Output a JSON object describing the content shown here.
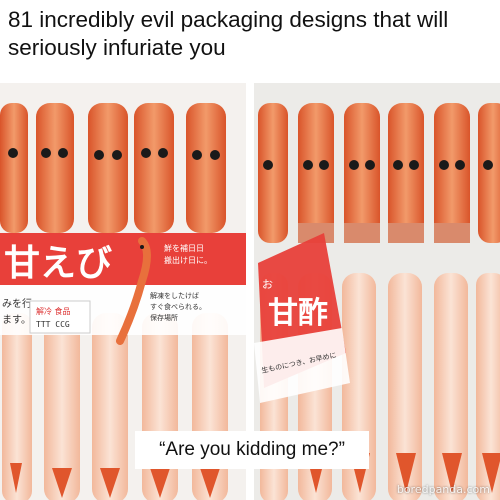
{
  "headline": "81 incredibly evil packaging designs that will seriously infuriate you",
  "left_photo": {
    "label_main": "甘えび",
    "label_small_1": "鮮を補日日",
    "label_small_2": "搬出け日に。",
    "label_small_3": "みを行",
    "label_small_4": "ます。",
    "label_small_5": "解凍をしたけば",
    "label_small_6": "すぐ食べられる。",
    "label_small_7": "保存場所",
    "sticker_text": "解冷 食品",
    "sticker_code": "TTT CCG"
  },
  "right_photo": {
    "label_main": "甘酢",
    "label_prefix": "お",
    "label_small": "生ものにつき、お早めに"
  },
  "caption": "“Are you kidding me?”",
  "watermark": "boredpanda.com",
  "colors": {
    "label_red": "#e8403a",
    "shrimp_orange": "#e8703c",
    "tray_white": "#f4f1ee"
  }
}
